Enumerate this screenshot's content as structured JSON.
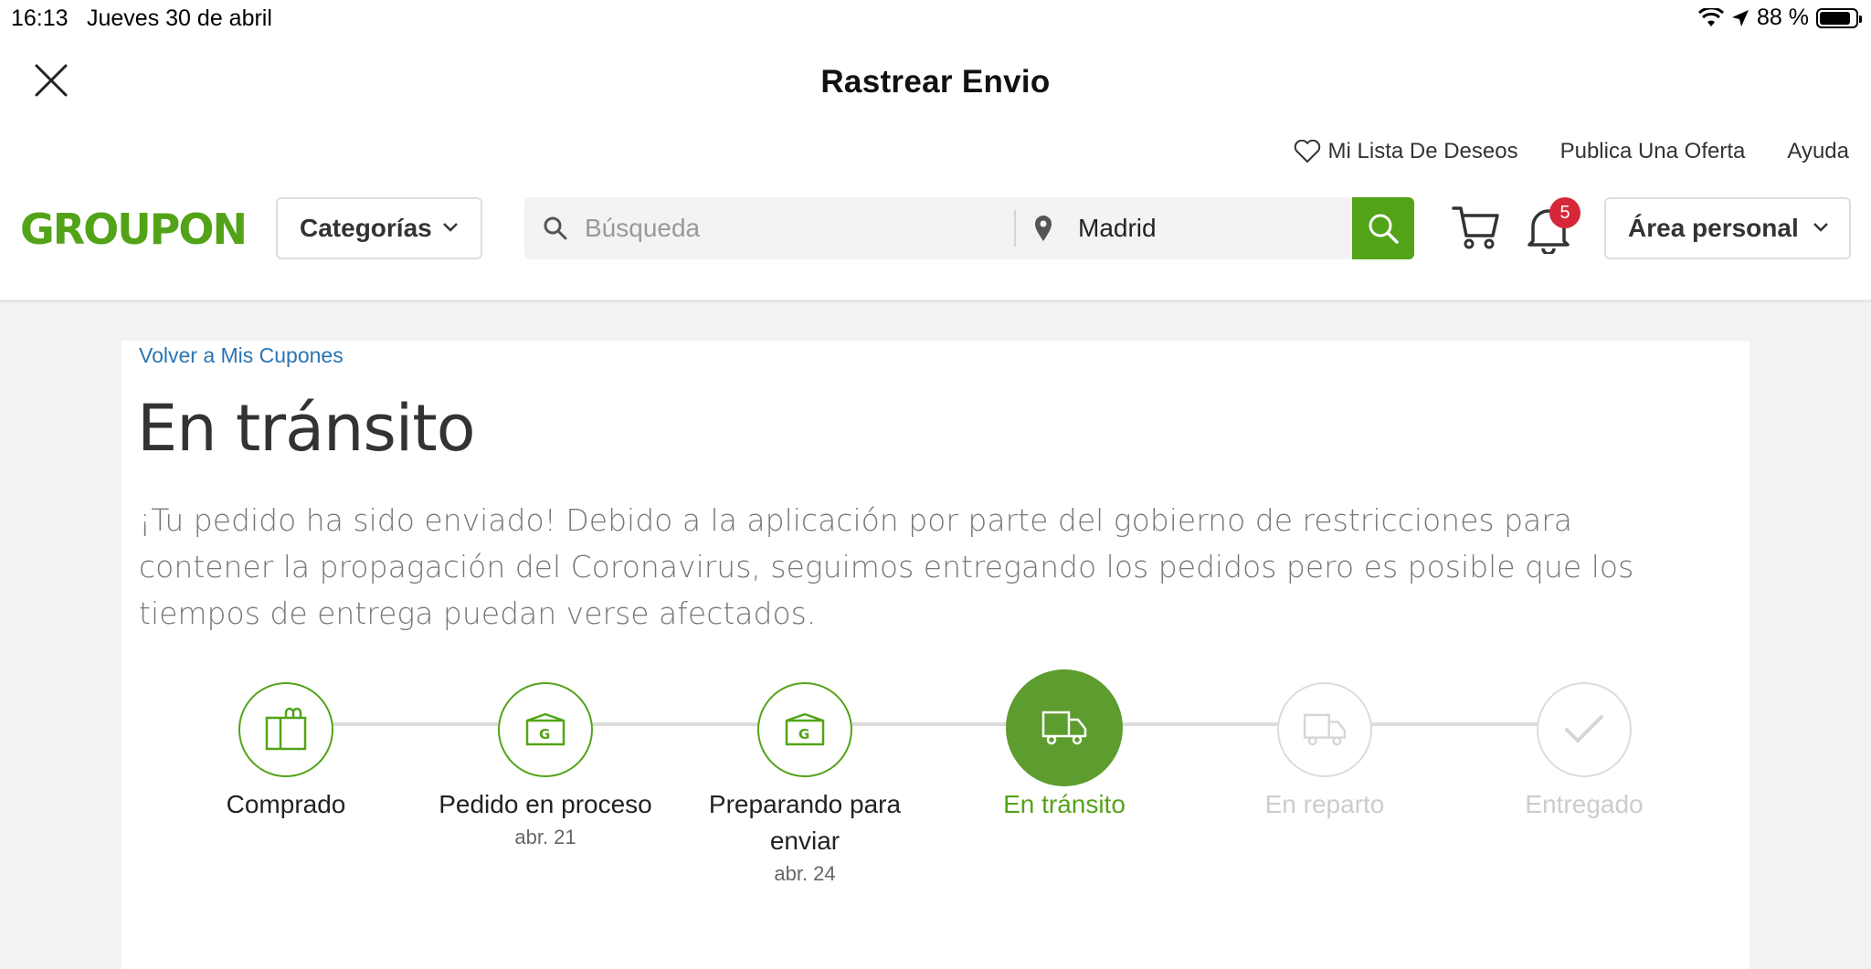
{
  "status_bar": {
    "time": "16:13",
    "date": "Jueves 30 de abril",
    "battery": "88 %"
  },
  "nav": {
    "title": "Rastrear Envio"
  },
  "header": {
    "links": {
      "wishlist": "Mi Lista De Deseos",
      "publish": "Publica Una Oferta",
      "help": "Ayuda"
    },
    "logo": "GROUPON",
    "categories_label": "Categorías",
    "search_placeholder": "Búsqueda",
    "location_value": "Madrid",
    "notification_count": "5",
    "account_label": "Área personal"
  },
  "content": {
    "back_link": "Volver a Mis Cupones",
    "title": "En tránsito",
    "description": "¡Tu pedido ha sido enviado! Debido a la aplicación por parte del gobierno de restricciones para contener la propagación del Coronavirus, seguimos entregando los pedidos pero es posible que los tiempos de entrega puedan verse afectados."
  },
  "tracker": {
    "steps": [
      {
        "label": "Comprado",
        "date": "",
        "state": "done",
        "icon": "shopping-bag-icon"
      },
      {
        "label": "Pedido en proceso",
        "date": "abr. 21",
        "state": "done",
        "icon": "groupon-box-icon"
      },
      {
        "label": "Preparando para enviar",
        "date": "abr. 24",
        "state": "done",
        "icon": "groupon-box-icon"
      },
      {
        "label": "En tránsito",
        "date": "",
        "state": "current",
        "icon": "truck-icon"
      },
      {
        "label": "En reparto",
        "date": "",
        "state": "pending",
        "icon": "truck-icon"
      },
      {
        "label": "Entregado",
        "date": "",
        "state": "pending",
        "icon": "checkmark-icon"
      }
    ]
  },
  "colors": {
    "brand_green": "#53a318",
    "active_green": "#5d9c2e",
    "link_blue": "#2a74b4",
    "badge_red": "#d62738",
    "inactive_gray": "#cccccc"
  }
}
